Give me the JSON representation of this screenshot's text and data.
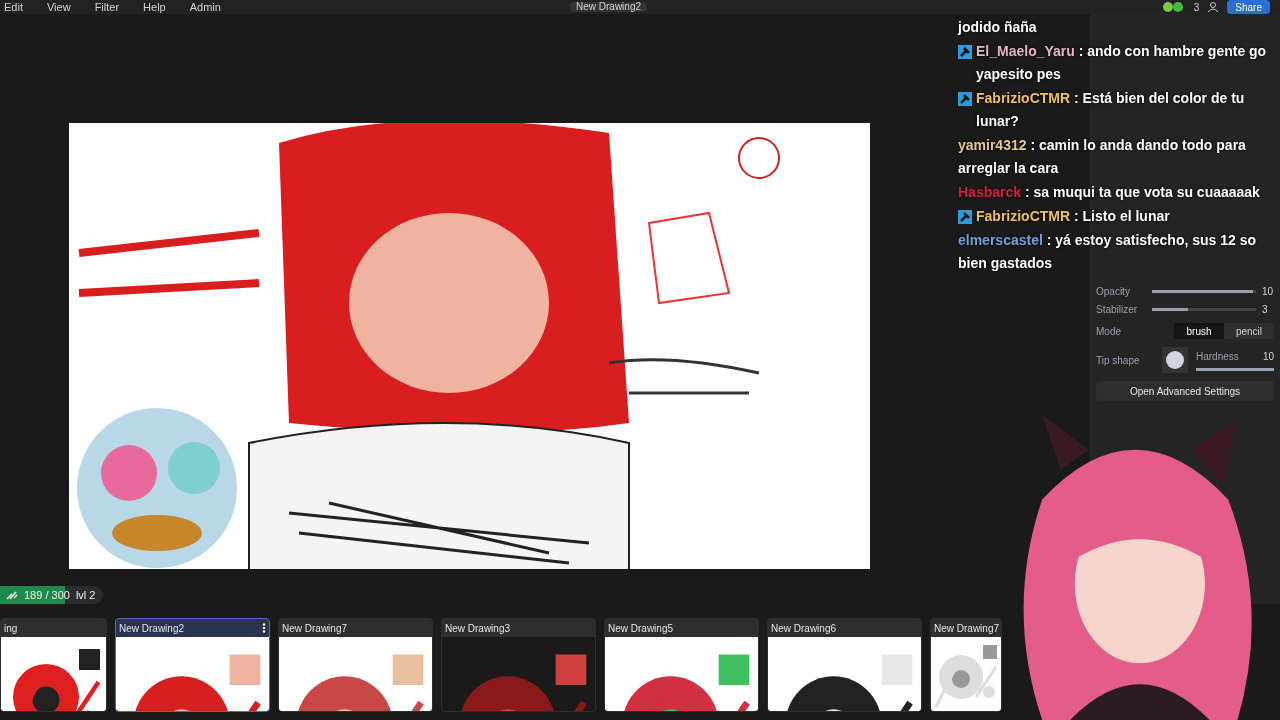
{
  "menu": [
    "Edit",
    "View",
    "Filter",
    "Help",
    "Admin"
  ],
  "document_tab": "New Drawing2",
  "top_right": {
    "count": "3",
    "share": "Share"
  },
  "sliders": [
    {
      "label": "Opacity",
      "level": 0.97,
      "reading": "10"
    },
    {
      "label": "Stabilizer",
      "level": 0.35,
      "reading": "3"
    }
  ],
  "mode": {
    "label": "Mode",
    "options": [
      {
        "label": "brush",
        "selected": true
      },
      {
        "label": "pencil",
        "selected": false
      }
    ]
  },
  "tip": {
    "label": "Tip shape",
    "hardness_label": "Hardness",
    "hardness_reading": "10",
    "level": 1
  },
  "advanced_button": "Open Advanced Settings",
  "chat": [
    {
      "kind": "text",
      "badge": false,
      "text": "jodido ñaña"
    },
    {
      "kind": "message",
      "user": "El_Maelo_Yaru",
      "color": "#e8b4c8",
      "badge": true,
      "text": ": ando con hambre gente go yapesito pes"
    },
    {
      "kind": "message",
      "user": "FabrizioCTMR",
      "color": "#f0c060",
      "badge": true,
      "text": ": Está bien del color de tu lunar?"
    },
    {
      "kind": "message",
      "user": "yamir4312",
      "color": "#e8c890",
      "badge": false,
      "text": ": camin lo anda dando todo para arreglar la cara"
    },
    {
      "kind": "message",
      "user": "Hasbarck",
      "color": "#d02040",
      "badge": false,
      "text": ": sa muqui ta que vota su cuaaaaak"
    },
    {
      "kind": "message",
      "user": "FabrizioCTMR",
      "color": "#f0c060",
      "badge": true,
      "text": ": Listo el lunar"
    },
    {
      "kind": "message",
      "user": "elmerscastel",
      "color": "#70a0e0",
      "badge": false,
      "text": ": yá estoy satisfecho, sus 12 so bien gastados"
    }
  ],
  "progress": {
    "reading": "189 / 300",
    "level_text": "lvl 2",
    "level": 0.63
  },
  "drawings": [
    {
      "title": "ing",
      "selected": false
    },
    {
      "title": "New Drawing2",
      "selected": true
    },
    {
      "title": "New Drawing7",
      "selected": false
    },
    {
      "title": "New Drawing3",
      "selected": false
    },
    {
      "title": "New Drawing5",
      "selected": false
    },
    {
      "title": "New Drawing6",
      "selected": false
    },
    {
      "title": "New Drawing7",
      "selected": false
    }
  ]
}
